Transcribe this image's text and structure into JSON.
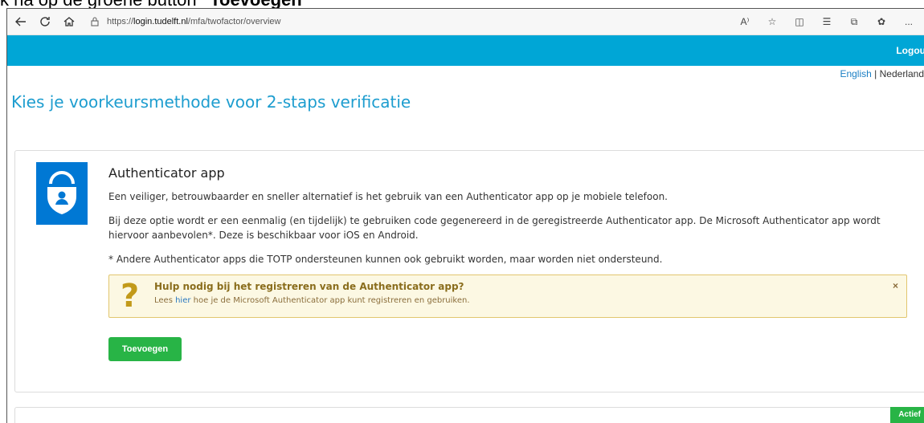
{
  "caption": {
    "prefix": "k na op de groene button ",
    "bold": "\"Toevoegen\""
  },
  "browser": {
    "url_prefix": "https://",
    "url_host": "login.tudelft.nl",
    "url_path": "/mfa/twofactor/overview",
    "more_label": "..."
  },
  "header": {
    "logout_label": "Logout"
  },
  "language": {
    "english": "English",
    "separator": "|",
    "dutch": "Nederlands"
  },
  "page": {
    "title": "Kies je voorkeursmethode voor 2-staps verificatie"
  },
  "card": {
    "title": "Authenticator app",
    "para1": "Een veiliger, betrouwbaarder en sneller alternatief is het gebruik van een Authenticator app op je mobiele telefoon.",
    "para2": "Bij deze optie wordt er een eenmalig (en tijdelijk) te gebruiken code gegenereerd in de geregistreerde Authenticator app. De Microsoft Authenticator app wordt hiervoor aanbevolen*. Deze is beschikbaar voor iOS en Android.",
    "para3": "* Andere Authenticator apps die TOTP ondersteunen kunnen ook gebruikt worden, maar worden niet ondersteund.",
    "help": {
      "title": "Hulp nodig bij het registreren van de Authenticator app?",
      "text_before": "Lees ",
      "link": "hier",
      "text_after": " hoe je de Microsoft Authenticator app kunt registreren en gebruiken.",
      "close": "×"
    },
    "add_button": "Toevoegen"
  },
  "status_badge": "Actief",
  "colors": {
    "header": "#00a6d6",
    "button": "#28b446",
    "title": "#1d9dcf"
  }
}
